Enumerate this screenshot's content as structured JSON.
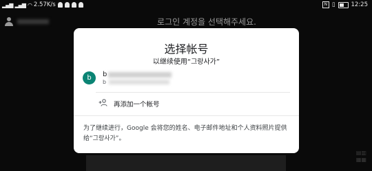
{
  "status_bar": {
    "speed": "2.57K/s",
    "time": "12:25",
    "battery_level": 0.55
  },
  "background": {
    "title": "로그인 계정을 선택해주세요."
  },
  "dialog": {
    "title": "选择帐号",
    "subtitle": "以继续使用“그랑사가”",
    "account": {
      "avatar_letter": "b",
      "name_visible": "b",
      "email_visible": "b"
    },
    "add_account_label": "再添加一个帐号",
    "footer": "为了继续进行，Google 会将您的姓名、电子邮件地址和个人资料照片提供给“그랑사가”。"
  },
  "colors": {
    "avatar": "#0b8474",
    "dialog_bg": "#ffffff",
    "backdrop": "#0a0a0a"
  }
}
